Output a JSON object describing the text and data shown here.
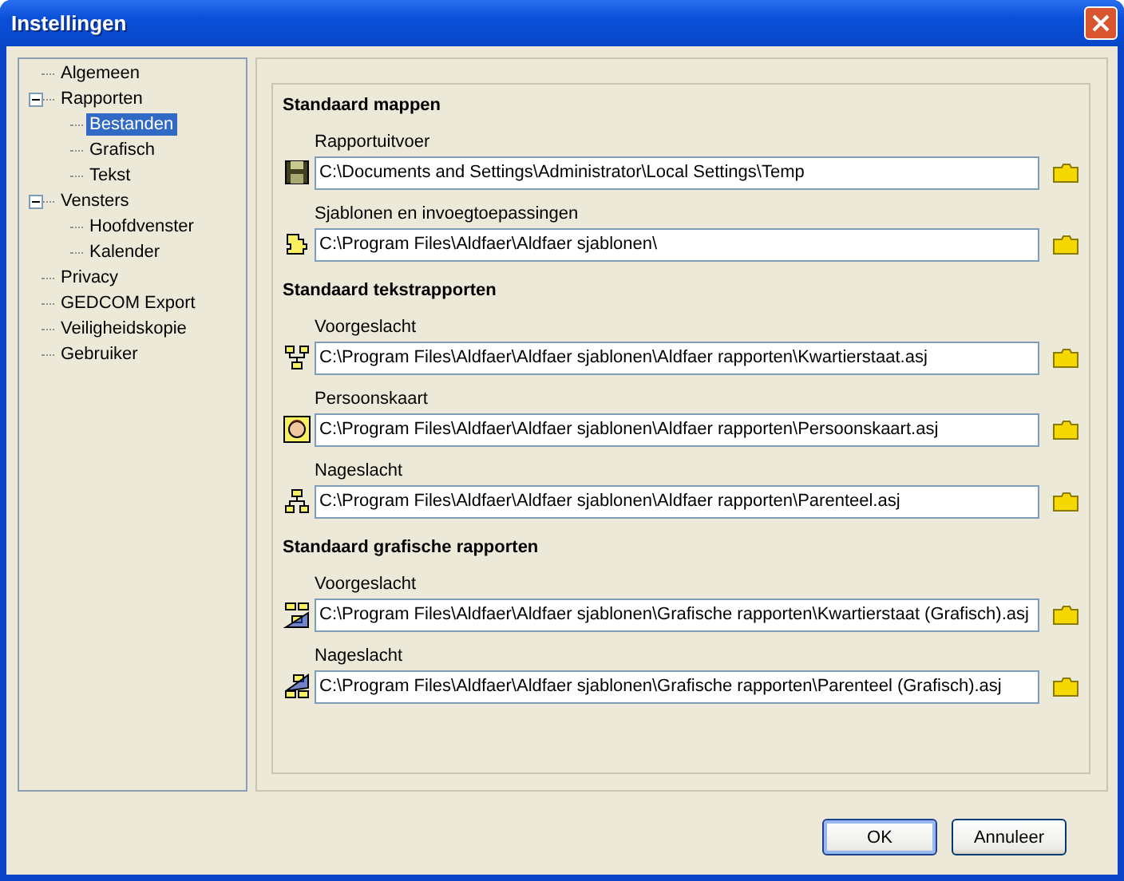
{
  "window": {
    "title": "Instellingen"
  },
  "tree": [
    {
      "label": "Algemeen",
      "selected": false
    },
    {
      "label": "Rapporten",
      "selected": false,
      "expanded": true,
      "children": [
        {
          "label": "Bestanden",
          "selected": true
        },
        {
          "label": "Grafisch",
          "selected": false
        },
        {
          "label": "Tekst",
          "selected": false
        }
      ]
    },
    {
      "label": "Vensters",
      "selected": false,
      "expanded": true,
      "children": [
        {
          "label": "Hoofdvenster",
          "selected": false
        },
        {
          "label": "Kalender",
          "selected": false
        }
      ]
    },
    {
      "label": "Privacy",
      "selected": false
    },
    {
      "label": "GEDCOM Export",
      "selected": false
    },
    {
      "label": "Veiligheidskopie",
      "selected": false
    },
    {
      "label": "Gebruiker",
      "selected": false
    }
  ],
  "sections": [
    {
      "title": "Standaard mappen",
      "fields": [
        {
          "label": "Rapportuitvoer",
          "kind": "floppy",
          "value": "C:\\Documents and Settings\\Administrator\\Local Settings\\Temp"
        },
        {
          "label": "Sjablonen en invoegtoepassingen",
          "kind": "puzzle",
          "value": "C:\\Program Files\\Aldfaer\\Aldfaer sjablonen\\"
        }
      ]
    },
    {
      "title": "Standaard tekstrapporten",
      "fields": [
        {
          "label": "Voorgeslacht",
          "kind": "ancestors",
          "value": "C:\\Program Files\\Aldfaer\\Aldfaer sjablonen\\Aldfaer rapporten\\Kwartierstaat.asj"
        },
        {
          "label": "Persoonskaart",
          "kind": "person",
          "value": "C:\\Program Files\\Aldfaer\\Aldfaer sjablonen\\Aldfaer rapporten\\Persoonskaart.asj"
        },
        {
          "label": "Nageslacht",
          "kind": "descendants",
          "value": "C:\\Program Files\\Aldfaer\\Aldfaer sjablonen\\Aldfaer rapporten\\Parenteel.asj"
        }
      ]
    },
    {
      "title": "Standaard grafische rapporten",
      "fields": [
        {
          "label": "Voorgeslacht",
          "kind": "graphic-ancestors",
          "value": "C:\\Program Files\\Aldfaer\\Aldfaer sjablonen\\Grafische rapporten\\Kwartierstaat (Grafisch).asj"
        },
        {
          "label": "Nageslacht",
          "kind": "graphic-descendants",
          "value": "C:\\Program Files\\Aldfaer\\Aldfaer sjablonen\\Grafische rapporten\\Parenteel (Grafisch).asj"
        }
      ]
    }
  ],
  "buttons": [
    {
      "label": "OK",
      "default": true
    },
    {
      "label": "Annuleer",
      "default": false
    }
  ]
}
